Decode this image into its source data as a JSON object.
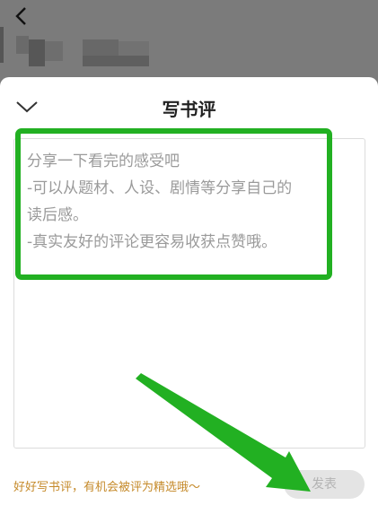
{
  "sheet": {
    "title": "写书评",
    "placeholder_lines": [
      "分享一下看完的感受吧",
      "-可以从题材、人设、剧情等分享自己的",
      "读后感。",
      "-真实友好的评论更容易收获点赞哦。"
    ],
    "tip": "好好写书评，有机会被评为精选哦～",
    "publish_label": "发表"
  },
  "colors": {
    "accent_tip": "#c58a2a",
    "annotation": "#22b022",
    "button_bg": "#e4e4e4"
  },
  "icons": {
    "back": "chevron-left-icon",
    "collapse": "chevron-down-icon"
  }
}
